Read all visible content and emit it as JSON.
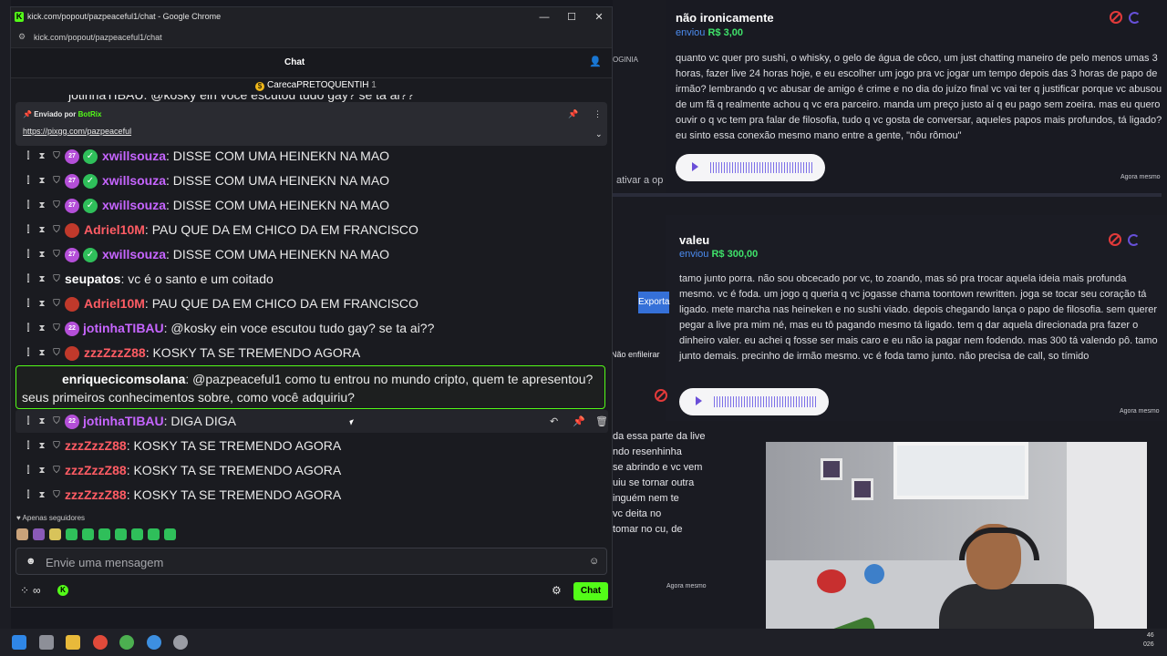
{
  "window": {
    "title": "kick.com/popout/pazpeaceful1/chat - Google Chrome",
    "url": "kick.com/popout/pazpeaceful1/chat",
    "favicon_letter": "K",
    "min": "—",
    "max": "☐",
    "close": "✕"
  },
  "chat": {
    "header": "Chat",
    "top_pinned": {
      "user": "CarecaPRETOQUENTIH",
      "count": "1"
    },
    "partial_row": "jotinhaTIBAU: @kosky ein voce escutou tudo gay? se ta ai??",
    "pinned": {
      "by_label": "Enviado por",
      "bot_name": "BotRix",
      "link": "https://pixgg.com/pazpeaceful"
    },
    "messages": [
      {
        "user": "xwillsouza",
        "sep": ":",
        "text": " DISSE COM UMA HEINEKN NA MAO",
        "badge": "27",
        "verified": true,
        "color": "purple"
      },
      {
        "user": "xwillsouza",
        "sep": ":",
        "text": " DISSE COM UMA HEINEKN NA MAO",
        "badge": "27",
        "verified": true,
        "color": "purple"
      },
      {
        "user": "xwillsouza",
        "sep": ":",
        "text": " DISSE COM UMA HEINEKN NA MAO",
        "badge": "27",
        "verified": true,
        "color": "purple"
      },
      {
        "user": "Adriel10M",
        "sep": ":",
        "text": " PAU QUE DA EM CHICO DA EM FRANCISCO",
        "badge": "",
        "verified": false,
        "color": "red"
      },
      {
        "user": "xwillsouza",
        "sep": ":",
        "text": " DISSE COM UMA HEINEKN NA MAO",
        "badge": "27",
        "verified": true,
        "color": "purple"
      },
      {
        "user": "seupatos",
        "sep": ":",
        "text": " vc é o santo e um coitado",
        "badge": "",
        "verified": false,
        "color": "white"
      },
      {
        "user": "Adriel10M",
        "sep": ":",
        "text": " PAU QUE DA EM CHICO DA EM FRANCISCO",
        "badge": "",
        "verified": false,
        "color": "red"
      },
      {
        "user": "jotinhaTIBAU",
        "sep": ":",
        "text": " @kosky ein voce escutou tudo gay? se ta ai??",
        "badge": "22",
        "verified": false,
        "color": "purple"
      },
      {
        "user": "zzzZzzZ88",
        "sep": ":",
        "text": " KOSKY TA SE TREMENDO AGORA",
        "badge": "",
        "verified": false,
        "color": "red"
      }
    ],
    "highlighted": {
      "user": "enriquecicomsolana",
      "text": ": @pazpeaceful1 como tu entrou no mundo cripto, quem te apresentou? seus primeiros conhecimentos sobre, como você adquiriu?"
    },
    "hover_msg": {
      "user": "jotinhaTIBAU",
      "text": ": DIGA DIGA",
      "badge": "22"
    },
    "tail_messages": [
      {
        "user": "zzzZzzZ88",
        "text": ": KOSKY TA SE TREMENDO AGORA"
      },
      {
        "user": "zzzZzzZ88",
        "text": ": KOSKY TA SE TREMENDO AGORA"
      },
      {
        "user": "zzzZzzZ88",
        "text": ": KOSKY TA SE TREMENDO AGORA"
      }
    ],
    "followers_only": "Apenas seguidores",
    "input_placeholder": "Envie uma mensagem",
    "send_label": "Chat",
    "infinity": "∞"
  },
  "donations": [
    {
      "name": "não ironicamente",
      "sent_label": "enviou",
      "amount": "R$ 3,00",
      "text": "quanto vc quer pro sushi, o whisky, o gelo de água de côco, um just chatting maneiro de pelo menos umas 3 horas, fazer live 24 horas hoje, e eu escolher um jogo pra vc jogar um tempo depois das 3 horas de papo de irmão? lembrando q vc abusar de amigo é crime e no dia do juízo final vc vai ter q justificar porque vc abusou de um fã q realmente achou q vc era parceiro. manda um preço justo aí q eu pago sem zoeira. mas eu quero ouvir o q vc tem pra falar de filosofia, tudo q vc gosta de conversar, aqueles papos mais profundos, tá ligado? eu sinto essa conexão mesmo mano entre a gente, \"nôu rômou\"",
      "time": "Agora mesmo"
    },
    {
      "name": "valeu",
      "sent_label": "enviou",
      "amount": "R$ 300,00",
      "text": "tamo junto porra. não sou obcecado por vc, to zoando, mas só pra trocar aquela ideia mais profunda mesmo. vc é foda. um jogo q queria q vc jogasse chama toontown rewritten. joga se tocar seu coração tá ligado. mete marcha nas heineken e no sushi viado. depois chegando lança o papo de filosofia. sem querer pegar a live pra mim né, mas eu tô pagando mesmo tá ligado. tem q dar aquela direcionada pra fazer o dinheiro valer. eu achei q fosse ser mais caro e eu não ia pagar nem fodendo. mas 300 tá valendo pô. tamo junto demais. precinho de irmão mesmo. vc é foda tamo junto. não precisa de call, so tímido",
      "time": "Agora mesmo"
    }
  ],
  "side_fragments": {
    "ativar": "ativar a op",
    "export": "Exporta",
    "nao_enfileirar": "Não enfileirar",
    "left_text": [
      "da essa parte da live",
      "ndo resenhinha",
      "se abrindo e vc vem",
      "uiu se tornar outra",
      "inguém nem te",
      "vc deita no",
      "tomar no cu, de"
    ],
    "agora": "Agora mesmo",
    "top_fragment": "OGINIA"
  },
  "taskbar": {
    "clock": [
      "46",
      "026"
    ]
  }
}
